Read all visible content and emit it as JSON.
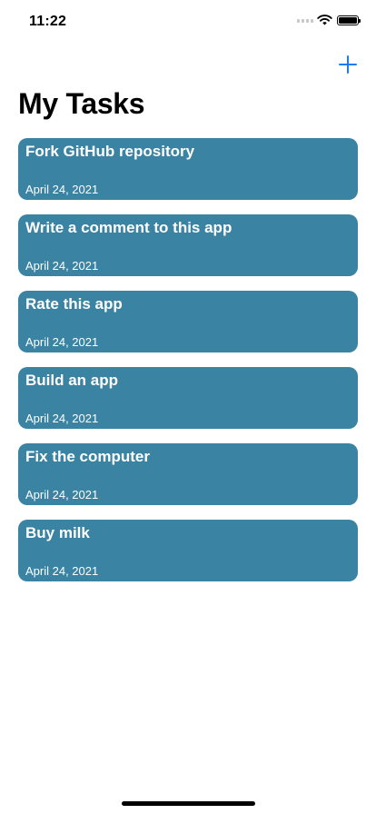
{
  "status_bar": {
    "time": "11:22"
  },
  "header": {
    "title": "My Tasks",
    "add_icon": "plus-icon",
    "accent_color": "#1a7bf2"
  },
  "tasks": [
    {
      "title": "Fork GitHub repository",
      "date": "April 24, 2021"
    },
    {
      "title": "Write a comment to this app",
      "date": "April 24, 2021"
    },
    {
      "title": "Rate this app",
      "date": "April 24, 2021"
    },
    {
      "title": "Build an app",
      "date": "April 24, 2021"
    },
    {
      "title": "Fix the computer",
      "date": "April 24, 2021"
    },
    {
      "title": "Buy milk",
      "date": "April 24, 2021"
    }
  ],
  "card_color": "#3a83a3"
}
